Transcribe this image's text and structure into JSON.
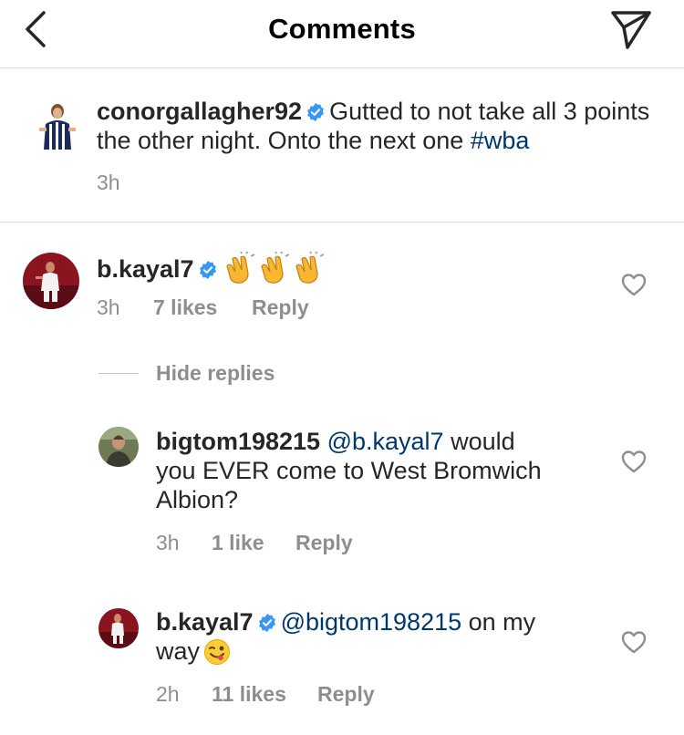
{
  "header": {
    "title": "Comments"
  },
  "caption": {
    "username": "conorgallagher92",
    "text": "Gutted to not take all 3 points the other night. Onto the next one",
    "hashtag": "#wba",
    "time": "3h"
  },
  "comments": [
    {
      "username": "b.kayal7",
      "emoji_name": "clapping-hands",
      "time": "3h",
      "likes": "7 likes",
      "reply": "Reply"
    }
  ],
  "hide_replies": "Hide replies",
  "replies": [
    {
      "username": "bigtom198215",
      "mention": "@b.kayal7",
      "text_line1": "would",
      "text_line2": "you EVER come to West Bromwich",
      "text_line3": "Albion?",
      "time": "3h",
      "likes": "1 like",
      "reply": "Reply"
    },
    {
      "username": "b.kayal7",
      "mention": "@bigtom198215",
      "text_line1": "on my",
      "text_line2": "way",
      "emoji_name": "winking-face-with-tongue",
      "time": "2h",
      "likes": "11 likes",
      "reply": "Reply"
    }
  ],
  "colors": {
    "link": "#00376b",
    "verified": "#3897f0",
    "muted": "#8e8e8e",
    "divider": "#dbdbdb"
  }
}
